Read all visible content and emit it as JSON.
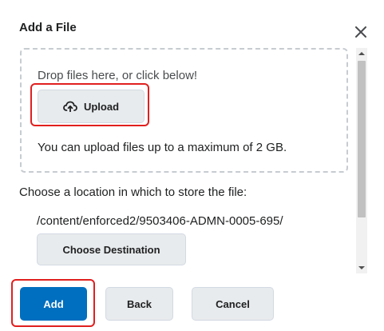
{
  "dialog": {
    "title": "Add a File",
    "close_icon": "close-icon"
  },
  "drop_zone": {
    "prompt": "Drop files here, or click below!",
    "upload_label": "Upload",
    "upload_icon": "cloud-upload-icon",
    "max_size_text": "You can upload files up to a maximum of 2 GB."
  },
  "location": {
    "label": "Choose a location in which to store the file:",
    "path": "/content/enforced2/9503406-ADMN-0005-695/",
    "choose_destination_label": "Choose Destination"
  },
  "footer": {
    "add_label": "Add",
    "back_label": "Back",
    "cancel_label": "Cancel"
  },
  "colors": {
    "primary": "#006fbf",
    "highlight": "#e0201f",
    "secondary_button": "#e8ebed"
  }
}
